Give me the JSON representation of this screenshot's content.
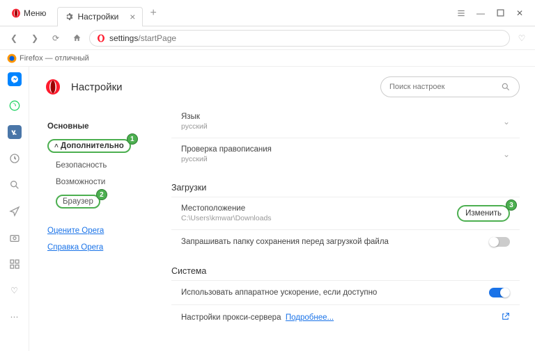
{
  "titlebar": {
    "menu": "Меню",
    "tab": "Настройки"
  },
  "address": {
    "prefix": "settings",
    "suffix": "/startPage"
  },
  "bookmark": "Firefox — отличный",
  "header": {
    "title": "Настройки"
  },
  "search": {
    "placeholder": "Поиск настроек"
  },
  "sidebar": {
    "main": "Основные",
    "advanced": "Дополнительно",
    "security": "Безопасность",
    "features": "Возможности",
    "browser": "Браузер",
    "rate": "Оцените Opera",
    "help": "Справка Opera"
  },
  "settings": {
    "lang_label": "Язык",
    "lang_value": "русский",
    "spell_label": "Проверка правописания",
    "spell_value": "русский",
    "downloads_section": "Загрузки",
    "location_label": "Местоположение",
    "location_value": "C:\\Users\\kmwar\\Downloads",
    "change_btn": "Изменить",
    "ask_label": "Запрашивать папку сохранения перед загрузкой файла",
    "system_section": "Система",
    "hw_label": "Использовать аппаратное ускорение, если доступно",
    "proxy_label": "Настройки прокси-сервера",
    "more_link": "Подробнее..."
  }
}
